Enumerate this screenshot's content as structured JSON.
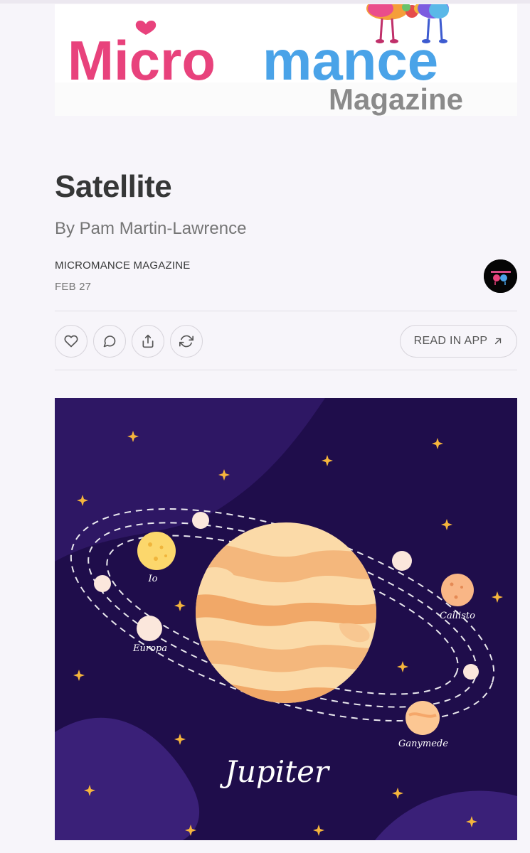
{
  "banner": {
    "logo_word_part1": "Micro",
    "logo_word_part2": "mance",
    "logo_sub": "Magazine",
    "colors": {
      "pink": "#e8427c",
      "blue": "#4aa3e8",
      "gray": "#888888"
    }
  },
  "post": {
    "title": "Satellite",
    "subtitle": "By Pam Martin-Lawrence",
    "publication": "MICROMANCE MAGAZINE",
    "date": "FEB 27"
  },
  "actions": {
    "like_icon": "heart-icon",
    "comment_icon": "comment-icon",
    "share_icon": "share-icon",
    "restack_icon": "restack-icon",
    "read_in_app_label": "READ IN APP",
    "read_in_app_icon": "arrow-up-right-icon"
  },
  "hero": {
    "planet_label": "Jupiter",
    "moons": [
      "Io",
      "Europa",
      "Callisto",
      "Ganymede"
    ],
    "colors": {
      "background": "#2a1558",
      "planet": "#f7c98b",
      "stars": "#f5b53c"
    }
  }
}
